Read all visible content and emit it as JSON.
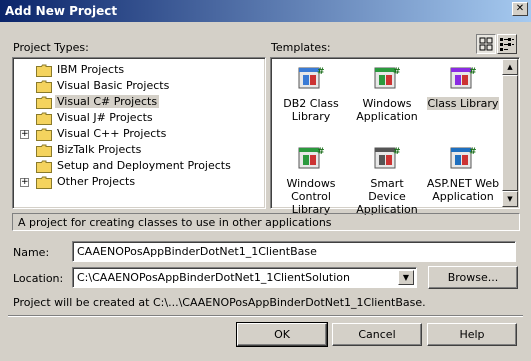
{
  "window": {
    "title": "Add New Project"
  },
  "project_types": {
    "label": "Project Types:",
    "items": [
      {
        "label": "IBM Projects",
        "expandable": false
      },
      {
        "label": "Visual Basic Projects",
        "expandable": false
      },
      {
        "label": "Visual C# Projects",
        "expandable": false,
        "selected": true
      },
      {
        "label": "Visual J# Projects",
        "expandable": false
      },
      {
        "label": "Visual C++ Projects",
        "expandable": true
      },
      {
        "label": "BizTalk Projects",
        "expandable": false
      },
      {
        "label": "Setup and Deployment Projects",
        "expandable": false
      },
      {
        "label": "Other Projects",
        "expandable": true
      }
    ]
  },
  "templates": {
    "label": "Templates:",
    "items": [
      {
        "label": "DB2 Class Library",
        "icon": "db2-class-library-icon"
      },
      {
        "label": "Windows Application",
        "icon": "windows-application-icon"
      },
      {
        "label": "Class Library",
        "icon": "class-library-icon",
        "selected": true
      },
      {
        "label": "Windows Control Library",
        "icon": "windows-control-library-icon"
      },
      {
        "label": "Smart Device Application",
        "icon": "smart-device-application-icon"
      },
      {
        "label": "ASP.NET Web Application",
        "icon": "aspnet-web-application-icon"
      }
    ]
  },
  "description": "A project for creating classes to use in other applications",
  "name": {
    "label": "Name:",
    "value": "CAAENOPosAppBinderDotNet1_1ClientBase"
  },
  "location": {
    "label": "Location:",
    "value": "C:\\CAAENOPosAppBinderDotNet1_1ClientSolution",
    "browse_label": "Browse..."
  },
  "created_at": "Project will be created at C:\\...\\CAAENOPosAppBinderDotNet1_1ClientBase.",
  "buttons": {
    "ok": "OK",
    "cancel": "Cancel",
    "help": "Help"
  },
  "colors": {
    "title_start": "#0a246a",
    "title_end": "#a6caf0",
    "face": "#d4d0c8",
    "folder": "#f4d35e"
  }
}
